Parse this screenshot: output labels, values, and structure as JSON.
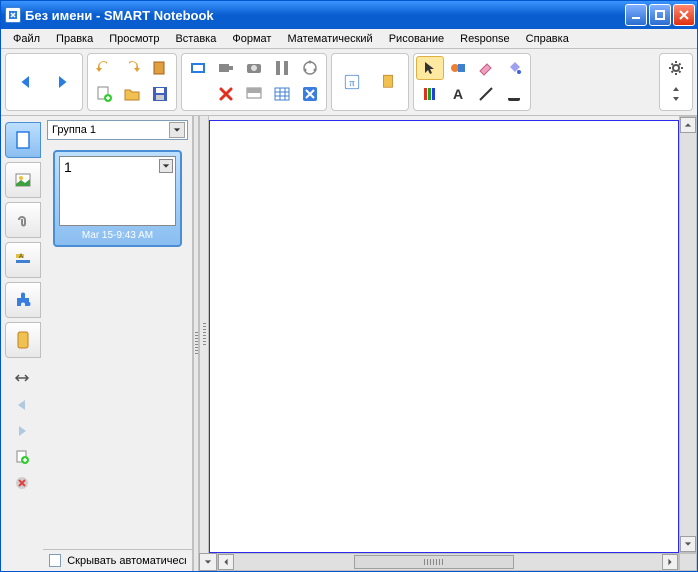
{
  "title": "Без имени - SMART Notebook",
  "menus": [
    "Файл",
    "Правка",
    "Просмотр",
    "Вставка",
    "Формат",
    "Математический",
    "Рисование",
    "Response",
    "Справка"
  ],
  "sidebar": {
    "group_label": "Группа 1",
    "thumb_number": "1",
    "thumb_time": "Mar 15-9:43 AM",
    "hide_auto_label": "Скрывать автоматически"
  },
  "icons": {
    "back": "back-arrow",
    "fwd": "forward-arrow",
    "undo": "undo",
    "redo": "redo",
    "open": "folder-open",
    "save": "disk",
    "new_page": "page-add",
    "delete_page": "page-remove"
  }
}
